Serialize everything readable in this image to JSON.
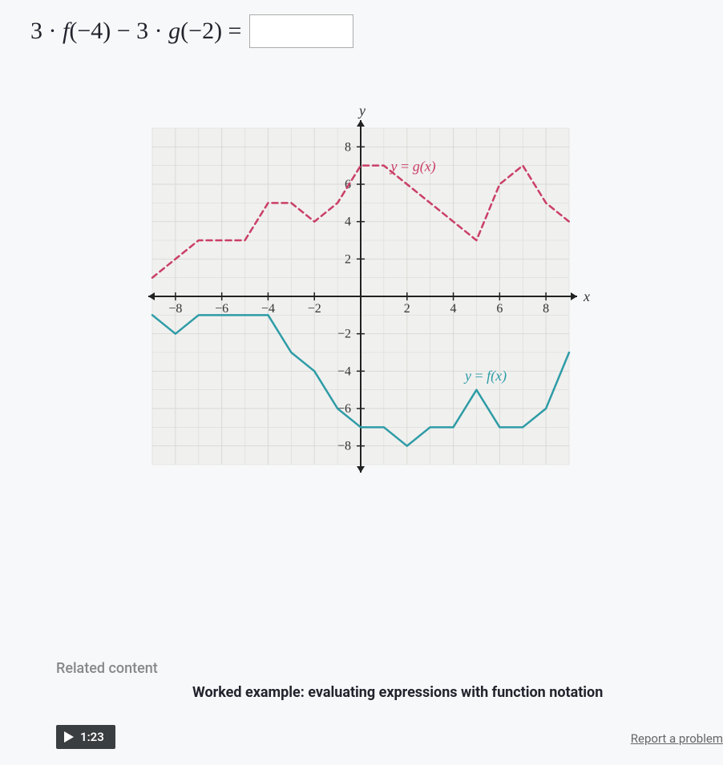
{
  "equation": {
    "text": "3 · f(−4) − 3 · g(−2) ="
  },
  "chart_data": {
    "type": "line",
    "title": "",
    "xlabel": "x",
    "ylabel": "y",
    "xlim": [
      -9,
      9
    ],
    "ylim": [
      -9,
      9
    ],
    "x_ticks": [
      -8,
      -6,
      -4,
      -2,
      2,
      4,
      6,
      8
    ],
    "y_ticks": [
      -8,
      -6,
      -4,
      -2,
      2,
      4,
      6,
      8
    ],
    "series": [
      {
        "name": "y = g(x)",
        "style": "dashed",
        "color": "#ca3f66",
        "x": [
          -9,
          -8,
          -7,
          -6,
          -5,
          -4,
          -3,
          -2,
          -1,
          0,
          1,
          2,
          3,
          4,
          5,
          6,
          7,
          8,
          9
        ],
        "values": [
          1,
          2,
          3,
          3,
          3,
          5,
          5,
          4,
          5,
          7,
          7,
          6,
          5,
          4,
          3,
          6,
          7,
          5,
          4
        ]
      },
      {
        "name": "y = f(x)",
        "style": "solid",
        "color": "#2e9ca6",
        "x": [
          -9,
          -8,
          -7,
          -6,
          -5,
          -4,
          -3,
          -2,
          -1,
          0,
          1,
          2,
          3,
          4,
          5,
          6,
          7,
          8,
          9
        ],
        "values": [
          -1,
          -2,
          -1,
          -1,
          -1,
          -1,
          -3,
          -4,
          -6,
          -7,
          -7,
          -8,
          -7,
          -7,
          -5,
          -7,
          -7,
          -6,
          -3
        ]
      }
    ],
    "legend": [
      {
        "label": "y = g(x)",
        "pos": [
          1.3,
          6.7
        ]
      },
      {
        "label": "y = f(x)",
        "pos": [
          4.5,
          -4.5
        ]
      }
    ]
  },
  "related": {
    "label": "Related content",
    "title": "Worked example: evaluating expressions with function notation"
  },
  "video": {
    "duration": "1:23"
  },
  "footer": {
    "report": "Report a problem"
  }
}
